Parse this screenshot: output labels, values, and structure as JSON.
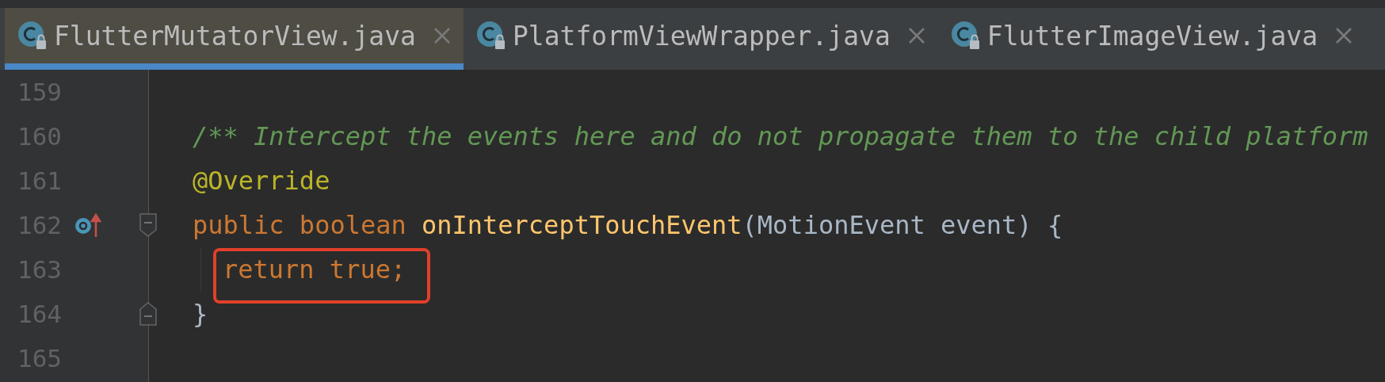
{
  "tabs": [
    {
      "label": "FlutterMutatorView.java",
      "selected": true
    },
    {
      "label": "PlatformViewWrapper.java",
      "selected": false
    },
    {
      "label": "FlutterImageView.java",
      "selected": false
    }
  ],
  "editor": {
    "lines": [
      {
        "number": "159"
      },
      {
        "number": "160",
        "tokens": [
          {
            "text": "/** Intercept the events here and do not propagate them to the child platform",
            "kind": "comment"
          }
        ]
      },
      {
        "number": "161",
        "tokens": [
          {
            "text": "@Override",
            "kind": "annotation"
          }
        ]
      },
      {
        "number": "162",
        "overrides": true,
        "fold_start": true,
        "tokens": [
          {
            "text": "public boolean ",
            "kind": "keyword"
          },
          {
            "text": "onInterceptTouchEvent",
            "kind": "method"
          },
          {
            "text": "(MotionEvent event) {",
            "kind": "plain"
          }
        ],
        "children": [
          {
            "number": "163",
            "highlighted": true,
            "tokens": [
              {
                "text": "return true;",
                "kind": "keyword"
              }
            ]
          }
        ]
      },
      {
        "number": "164",
        "fold_end": true,
        "tokens": [
          {
            "text": "}",
            "kind": "plain"
          }
        ]
      },
      {
        "number": "165"
      }
    ]
  }
}
